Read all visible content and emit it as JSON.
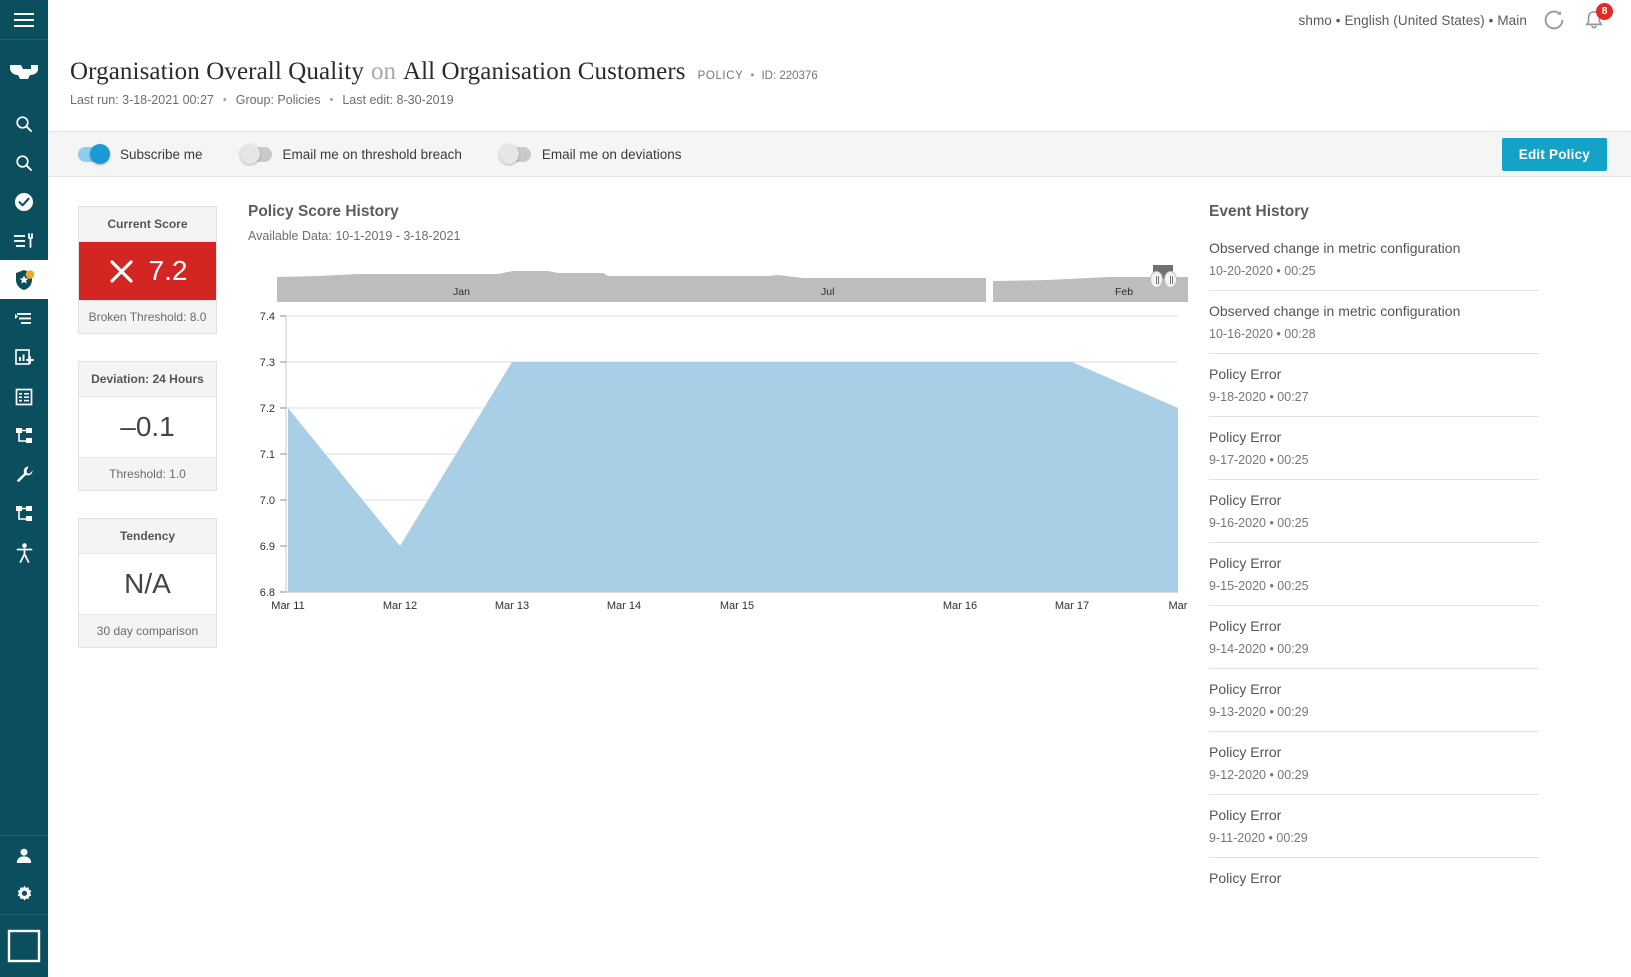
{
  "colors": {
    "sidebar": "#0b4e5e",
    "accent": "#13a3c7",
    "danger": "#d32622",
    "area_fill": "#a8cfe5",
    "navigator_fill": "#bdbdbd"
  },
  "topbar": {
    "user_meta": "shmo • English (United States) • Main",
    "refresh_icon": "refresh-clock-icon",
    "notifications_icon": "bell-icon",
    "notifications_count": "8"
  },
  "sidebar": {
    "menu_icon": "hamburger-menu-icon",
    "logo_icon": "anvil-logo-icon",
    "items": [
      {
        "name": "sidebar-item-search",
        "icon": "search-icon",
        "active": false
      },
      {
        "name": "sidebar-item-discovery",
        "icon": "search-icon",
        "active": false
      },
      {
        "name": "sidebar-item-quality",
        "icon": "check-circle-icon",
        "active": false
      },
      {
        "name": "sidebar-item-rules",
        "icon": "list-tools-icon",
        "active": false
      },
      {
        "name": "sidebar-item-policies",
        "icon": "shield-star-icon",
        "active": true
      },
      {
        "name": "sidebar-item-filters",
        "icon": "filter-icon",
        "active": false
      },
      {
        "name": "sidebar-item-reports",
        "icon": "chart-add-icon",
        "active": false
      },
      {
        "name": "sidebar-item-catalog",
        "icon": "table-icon",
        "active": false
      },
      {
        "name": "sidebar-item-lineage",
        "icon": "hierarchy-icon",
        "active": false
      },
      {
        "name": "sidebar-item-tools",
        "icon": "wrench-icon",
        "active": false
      },
      {
        "name": "sidebar-item-workflow",
        "icon": "hierarchy-icon",
        "active": false
      },
      {
        "name": "sidebar-item-accessibility",
        "icon": "accessibility-icon",
        "active": false
      }
    ],
    "bottom_items": [
      {
        "name": "sidebar-item-profile",
        "icon": "user-icon"
      },
      {
        "name": "sidebar-item-settings",
        "icon": "gear-icon"
      }
    ],
    "frame_icon": "panel-frame-icon"
  },
  "header": {
    "metric_name": "Organisation Overall Quality",
    "on_word": "on",
    "dataset_name": "All Organisation Customers",
    "kind": "POLICY",
    "separator": "•",
    "id_label": "ID: 220376",
    "last_run": "Last run: 3-18-2021 00:27",
    "group": "Group: Policies",
    "last_edit": "Last edit: 8-30-2019"
  },
  "toggles": [
    {
      "name": "subscribe-me-toggle",
      "label": "Subscribe me",
      "on": true
    },
    {
      "name": "email-threshold-breach-toggle",
      "label": "Email me on threshold breach",
      "on": false
    },
    {
      "name": "email-deviations-toggle",
      "label": "Email me on deviations",
      "on": false
    }
  ],
  "edit_button": {
    "label": "Edit Policy"
  },
  "cards": [
    {
      "name": "current-score-card",
      "head": "Current Score",
      "value": "7.2",
      "foot": "Broken Threshold: 8.0",
      "status": "danger",
      "icon": "x-mark-icon"
    },
    {
      "name": "deviation-card",
      "head": "Deviation: 24 Hours",
      "value": "–0.1",
      "foot": "Threshold: 1.0",
      "status": "normal",
      "icon": ""
    },
    {
      "name": "tendency-card",
      "head": "Tendency",
      "value": "N/A",
      "foot": "30 day comparison",
      "status": "normal",
      "icon": ""
    }
  ],
  "chart": {
    "title": "Policy Score History",
    "subtitle": "Available Data: 10-1-2019 - 3-18-2021"
  },
  "chart_data": {
    "type": "area",
    "title": "Policy Score History",
    "subtitle": "Available Data: 10-1-2019 - 3-18-2021",
    "xlabel": "",
    "ylabel": "",
    "ylim": [
      6.8,
      7.4
    ],
    "yticks": [
      "6.8",
      "6.9",
      "7.0",
      "7.1",
      "7.2",
      "7.3",
      "7.4"
    ],
    "grid": true,
    "legend": "none",
    "categories": [
      "Mar 11",
      "Mar 12",
      "Mar 13",
      "Mar 14",
      "Mar 15",
      "Mar 16",
      "Mar 17",
      "Mar"
    ],
    "xticks": [
      "Mar 11",
      "Mar 12",
      "Mar 13",
      "Mar 14",
      "Mar 15",
      "Mar 16",
      "Mar 17",
      "Mar"
    ],
    "series": [
      {
        "name": "Policy Score",
        "values": [
          7.2,
          6.9,
          7.3,
          7.3,
          7.3,
          7.3,
          7.3,
          7.2
        ]
      }
    ],
    "navigator": {
      "range_label": "10-1-2019 - 3-18-2021",
      "ticks": [
        "Jan",
        "Jul",
        "Feb"
      ]
    }
  },
  "events": {
    "title": "Event History",
    "items": [
      {
        "name": "Observed change in metric configuration",
        "time": "10-20-2020 • 00:25"
      },
      {
        "name": "Observed change in metric configuration",
        "time": "10-16-2020 • 00:28"
      },
      {
        "name": "Policy Error",
        "time": "9-18-2020 • 00:27"
      },
      {
        "name": "Policy Error",
        "time": "9-17-2020 • 00:25"
      },
      {
        "name": "Policy Error",
        "time": "9-16-2020 • 00:25"
      },
      {
        "name": "Policy Error",
        "time": "9-15-2020 • 00:25"
      },
      {
        "name": "Policy Error",
        "time": "9-14-2020 • 00:29"
      },
      {
        "name": "Policy Error",
        "time": "9-13-2020 • 00:29"
      },
      {
        "name": "Policy Error",
        "time": "9-12-2020 • 00:29"
      },
      {
        "name": "Policy Error",
        "time": "9-11-2020 • 00:29"
      },
      {
        "name": "Policy Error",
        "time": ""
      }
    ]
  }
}
